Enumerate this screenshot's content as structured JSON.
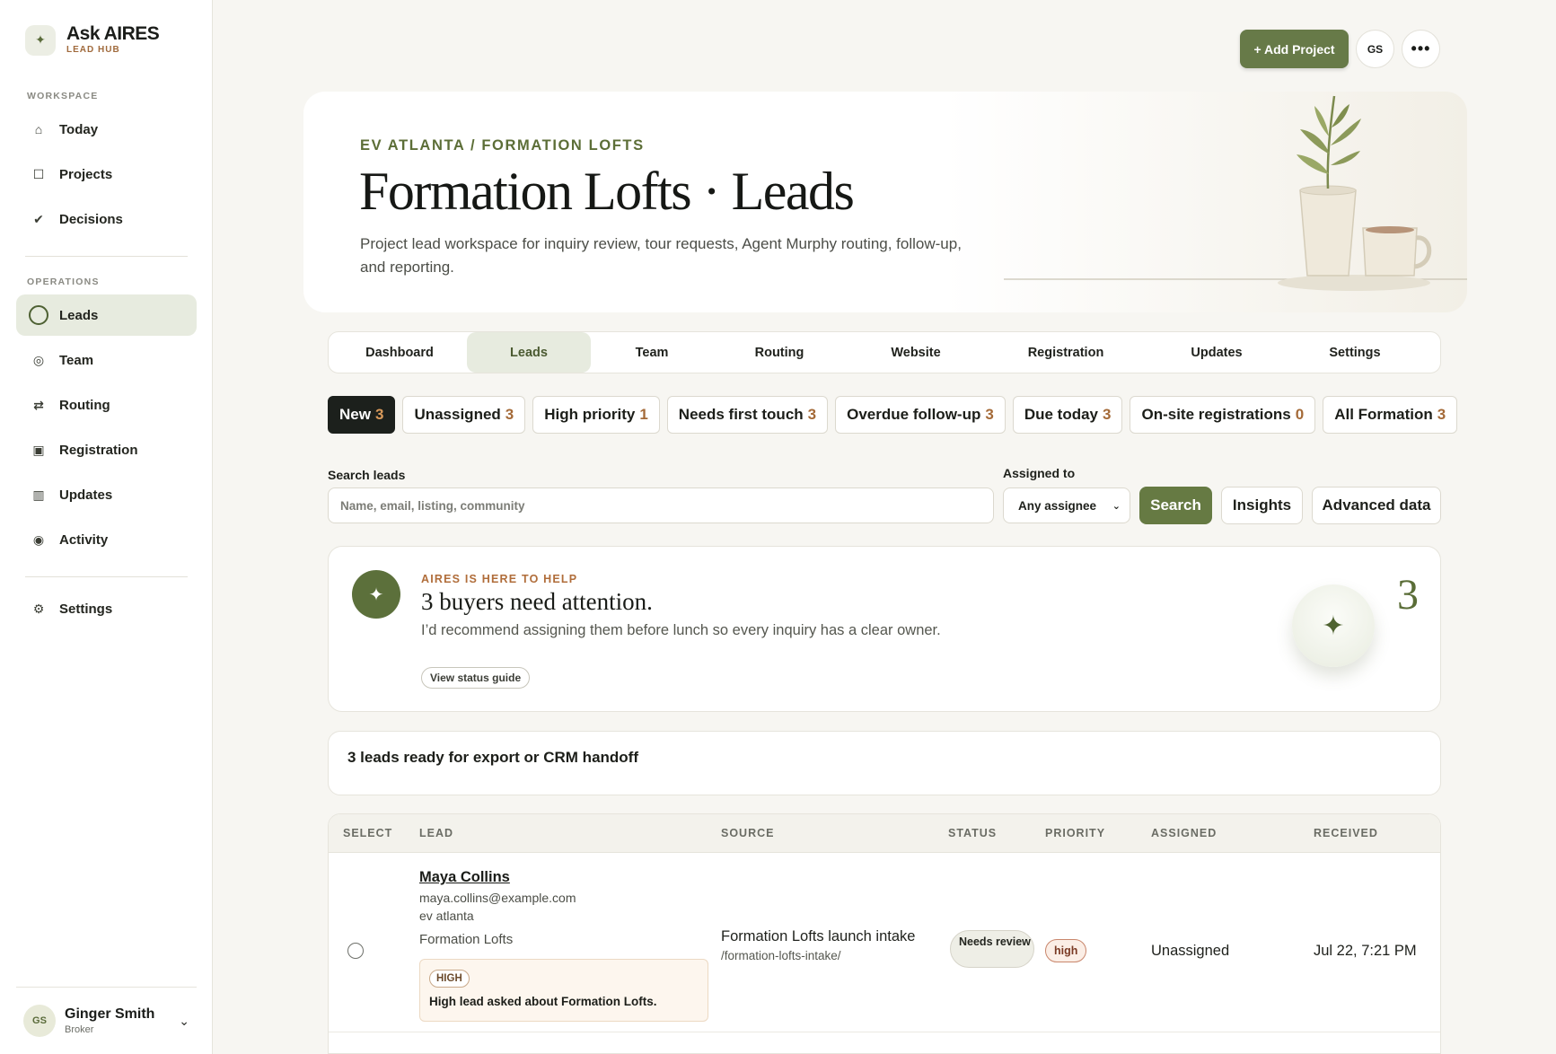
{
  "brand": {
    "title": "Ask AIRES",
    "subtitle": "LEAD HUB",
    "mark": "✦"
  },
  "sidebar": {
    "workspace_label": "WORKSPACE",
    "operations_label": "OPERATIONS",
    "workspace_items": [
      {
        "label": "Today",
        "icon": "home-icon"
      },
      {
        "label": "Projects",
        "icon": "square-icon"
      },
      {
        "label": "Decisions",
        "icon": "check-icon"
      }
    ],
    "operations_items": [
      {
        "label": "Leads",
        "icon": "ring-icon",
        "active": true
      },
      {
        "label": "Team",
        "icon": "target-icon"
      },
      {
        "label": "Routing",
        "icon": "arrows-icon"
      },
      {
        "label": "Registration",
        "icon": "form-icon"
      },
      {
        "label": "Updates",
        "icon": "grid-icon"
      },
      {
        "label": "Activity",
        "icon": "dot-icon"
      }
    ],
    "settings_label": "Settings"
  },
  "user": {
    "initials": "GS",
    "name": "Ginger Smith",
    "role": "Broker"
  },
  "header": {
    "add_project_label": "+ Add Project",
    "avatar_initials": "GS",
    "more_label": "•••"
  },
  "hero": {
    "eyebrow": "EV ATLANTA / FORMATION LOFTS",
    "title": "Formation Lofts · Leads",
    "description": "Project lead workspace for inquiry review, tour requests, Agent Murphy routing, follow-up, and reporting."
  },
  "tabs": [
    {
      "label": "Dashboard"
    },
    {
      "label": "Leads",
      "active": true
    },
    {
      "label": "Team"
    },
    {
      "label": "Routing"
    },
    {
      "label": "Website"
    },
    {
      "label": "Registration"
    },
    {
      "label": "Updates"
    },
    {
      "label": "Settings"
    }
  ],
  "filters": [
    {
      "label": "New",
      "count": "3",
      "active": true
    },
    {
      "label": "Unassigned",
      "count": "3"
    },
    {
      "label": "High priority",
      "count": "1"
    },
    {
      "label": "Needs first touch",
      "count": "3"
    },
    {
      "label": "Overdue follow-up",
      "count": "3"
    },
    {
      "label": "Due today",
      "count": "3"
    },
    {
      "label": "On-site registrations",
      "count": "0"
    },
    {
      "label": "All Formation",
      "count": "3"
    }
  ],
  "search": {
    "label": "Search leads",
    "placeholder": "Name, email, listing, community",
    "assigned_label": "Assigned to",
    "assignee_value": "Any assignee",
    "search_button": "Search",
    "insights_button": "Insights",
    "advanced_button": "Advanced data"
  },
  "aires": {
    "eyebrow": "AIRES IS HERE TO HELP",
    "title": "3 buyers need attention.",
    "description": "I’d recommend assigning them before lunch so every inquiry has a clear owner.",
    "guide_button": "View status guide",
    "count": "3",
    "mark": "✦"
  },
  "export": {
    "text": "3 leads ready for export or CRM handoff"
  },
  "table": {
    "columns": [
      "SELECT",
      "LEAD",
      "SOURCE",
      "STATUS",
      "PRIORITY",
      "ASSIGNED",
      "RECEIVED"
    ],
    "rows": [
      {
        "name": "Maya Collins",
        "email": "maya.collins@example.com",
        "city": "ev atlanta",
        "community": "Formation Lofts",
        "note_tag": "HIGH",
        "note_text": "High lead asked about Formation Lofts.",
        "source_title": "Formation Lofts launch intake",
        "source_path": "/formation-lofts-intake/",
        "status": "Needs review",
        "priority": "high",
        "assigned": "Unassigned",
        "received": "Jul 22, 7:21 PM"
      }
    ]
  },
  "colors": {
    "accent": "#677a48",
    "accent_dark": "#5c703b",
    "warm": "#a46a38",
    "active_bg": "#e7ebdf"
  }
}
